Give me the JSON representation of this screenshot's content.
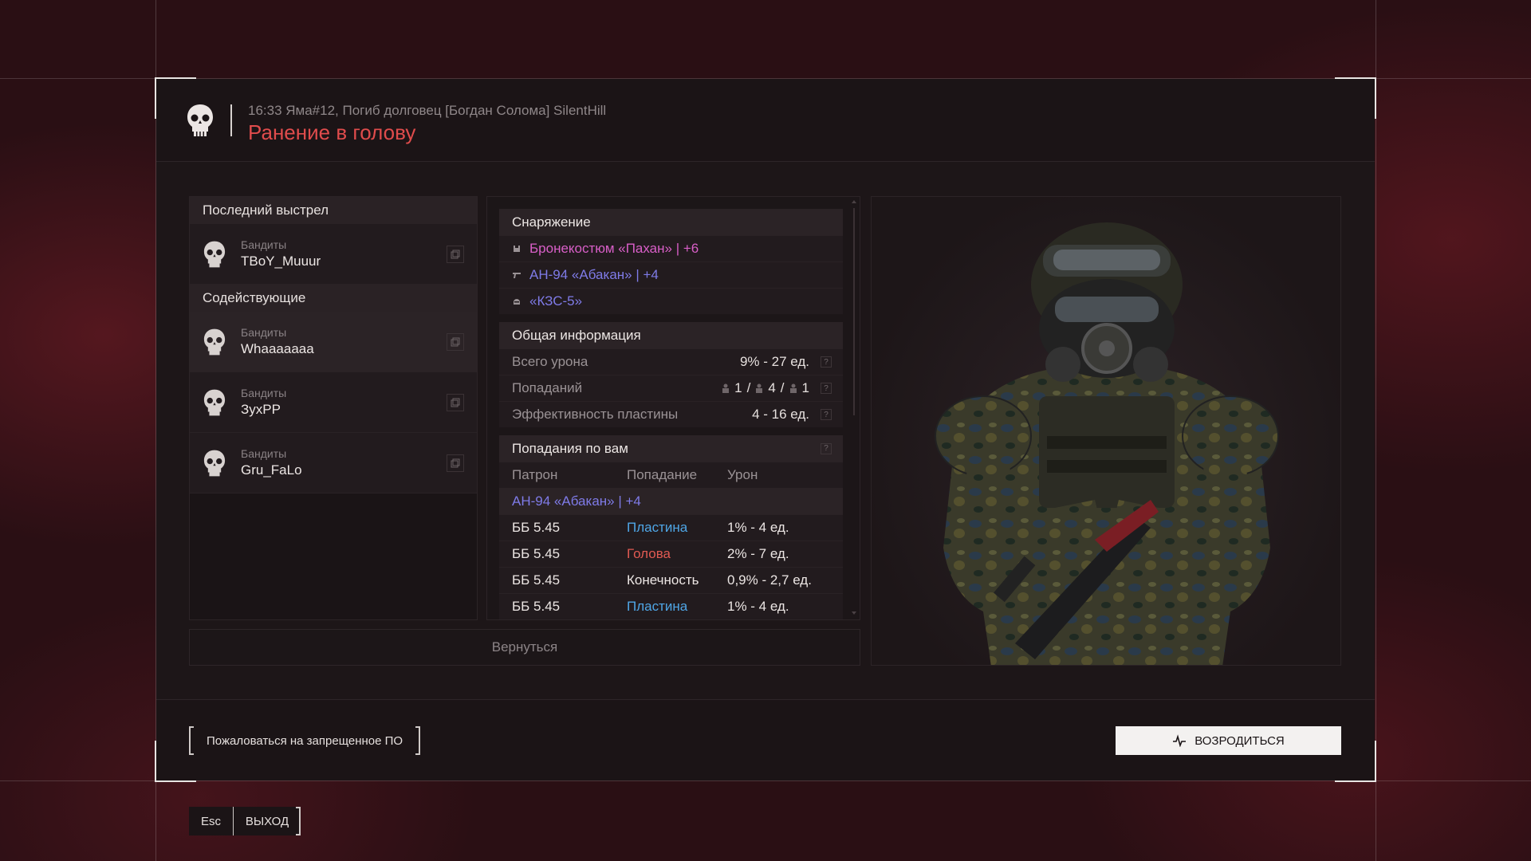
{
  "header": {
    "subtitle": "16:33 Яма#12, Погиб долговец [Богдан Солома] SilentHill",
    "title": "Ранение в голову"
  },
  "left": {
    "last_shot_label": "Последний выстрел",
    "killer": {
      "faction": "Бандиты",
      "name": "TBoY_Muuur"
    },
    "assists_label": "Содействующие",
    "assists": [
      {
        "faction": "Бандиты",
        "name": "Whaaaaaaa"
      },
      {
        "faction": "Бандиты",
        "name": "ЗухPP"
      },
      {
        "faction": "Бандиты",
        "name": "Gru_FaLo"
      }
    ]
  },
  "equipment": {
    "label": "Снаряжение",
    "items": [
      {
        "text": "Бронекостюм «Пахан» | +6",
        "color": "#d95fc8",
        "icon": "armor-icon"
      },
      {
        "text": "АН-94 «Абакан» | +4",
        "color": "#7f7be8",
        "icon": "rifle-icon"
      },
      {
        "text": "«КЗС-5»",
        "color": "#7f7be8",
        "icon": "helmet-icon"
      }
    ]
  },
  "general": {
    "label": "Общая информация",
    "total_damage_label": "Всего урона",
    "total_damage_value": "9% - 27 ед.",
    "hits_label": "Попаданий",
    "hits": [
      "1",
      "4",
      "1"
    ],
    "hits_sep": "/",
    "plate_label": "Эффективность пластины",
    "plate_value": "4 - 16 ед."
  },
  "hits_on_you": {
    "label": "Попадания по вам",
    "columns": [
      "Патрон",
      "Попадание",
      "Урон"
    ],
    "weapon": "АН-94 «Абакан» | +4",
    "rows": [
      {
        "ammo": "ББ 5.45",
        "hit": "Пластина",
        "hit_color": "#4fa6e6",
        "damage": "1% - 4 ед."
      },
      {
        "ammo": "ББ 5.45",
        "hit": "Голова",
        "hit_color": "#e05a52",
        "damage": "2% - 7 ед."
      },
      {
        "ammo": "ББ 5.45",
        "hit": "Конечность",
        "hit_color": "#ece6e4",
        "damage": "0,9% - 2,7 ед."
      },
      {
        "ammo": "ББ 5.45",
        "hit": "Пластина",
        "hit_color": "#4fa6e6",
        "damage": "1% - 4 ед."
      }
    ]
  },
  "buttons": {
    "back": "Вернуться",
    "report": "Пожаловаться на запрещенное ПО",
    "respawn": "ВОЗРОДИТЬСЯ",
    "esc_key": "Esc",
    "exit": "ВЫХОД"
  },
  "colors": {
    "accent_red": "#e04c4c",
    "rare_purple": "#7f7be8",
    "epic_pink": "#d95fc8"
  }
}
